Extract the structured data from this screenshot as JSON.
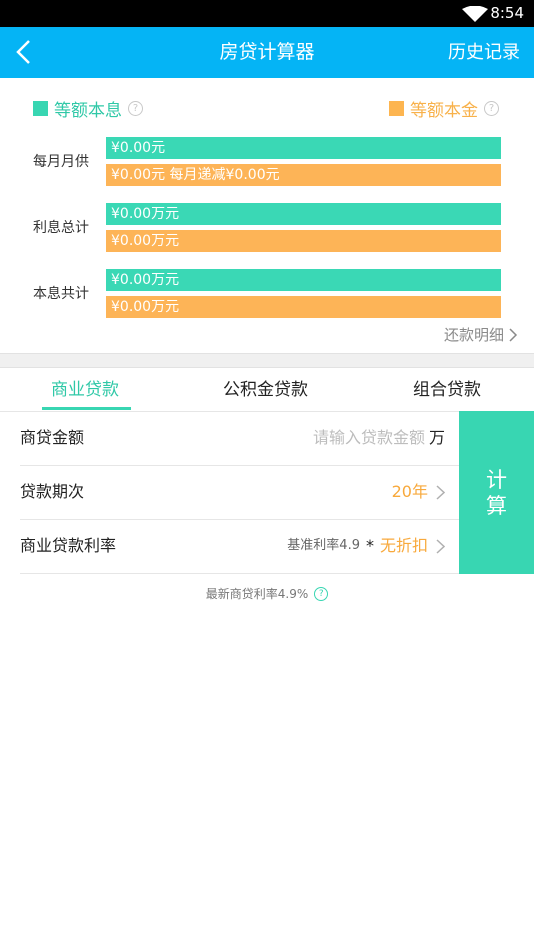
{
  "status": {
    "time": "8:54"
  },
  "header": {
    "title": "房贷计算器",
    "history": "历史记录"
  },
  "legend": {
    "equal_payment": "等额本息",
    "equal_principal": "等额本金",
    "help": "?"
  },
  "summary": {
    "monthly": {
      "label": "每月月供",
      "green": "¥0.00元",
      "orange": "¥0.00元  每月递减¥0.00元"
    },
    "interest": {
      "label": "利息总计",
      "green": "¥0.00万元",
      "orange": "¥0.00万元"
    },
    "total": {
      "label": "本息共计",
      "green": "¥0.00万元",
      "orange": "¥0.00万元"
    }
  },
  "detail_link": "还款明细",
  "tabs": [
    {
      "label": "商业贷款",
      "active": true
    },
    {
      "label": "公积金贷款",
      "active": false
    },
    {
      "label": "组合贷款",
      "active": false
    }
  ],
  "form": {
    "amount": {
      "label": "商贷金额",
      "placeholder": "请输入贷款金额",
      "unit": "万"
    },
    "term": {
      "label": "贷款期次",
      "value": "20年"
    },
    "rate": {
      "label": "商业贷款利率",
      "base": "基准利率4.9",
      "multiplier_sign": "*",
      "discount": "无折扣"
    }
  },
  "calc_button": {
    "line1": "计",
    "line2": "算"
  },
  "note": {
    "text": "最新商贷利率4.9%",
    "help": "?"
  },
  "colors": {
    "brand_blue": "#05b4f5",
    "green": "#3ad8b5",
    "orange": "#fdb457"
  }
}
